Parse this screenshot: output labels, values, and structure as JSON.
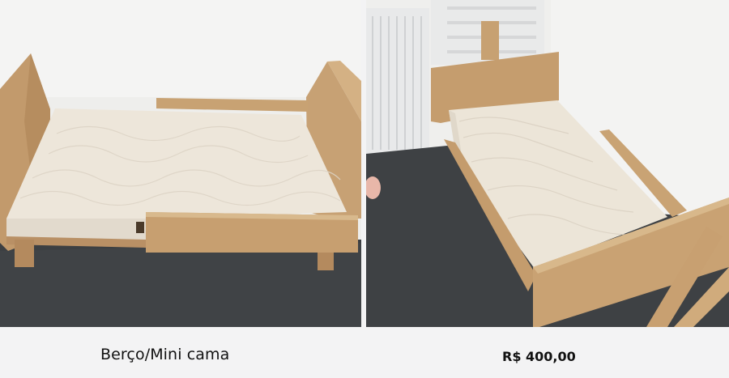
{
  "listing": {
    "title": "Berço/Mini cama",
    "price": "R$ 400,00"
  },
  "photos": [
    {
      "name": "photo-bed-front-view",
      "subject": "bed-with-mattress"
    },
    {
      "name": "photo-bed-side-view",
      "subject": "bed-with-mattress"
    }
  ],
  "colors": {
    "background": "#f3f3f4",
    "wood": "#c9a478",
    "mattress": "#efe9df",
    "floor": "#3d4043",
    "wall": "#f1f1f0"
  }
}
